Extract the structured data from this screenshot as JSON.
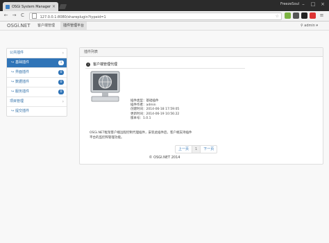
{
  "browser": {
    "tab_title": "OSGi System Manager",
    "tab_close": "×",
    "profile": "FreezeSoul",
    "minimize": "–",
    "maximize": "□",
    "close": "×",
    "back": "←",
    "forward": "→",
    "reload": "C",
    "url": "127.0.0.1:8080/shareplugin?typeid=1",
    "star": "☆"
  },
  "navbar": {
    "brand": "OSGi.NET",
    "items": [
      "客户端管理",
      "插件管理平台"
    ],
    "user": "admin"
  },
  "sidebar": {
    "items": [
      {
        "label": "公共插件",
        "chev": "›"
      },
      {
        "label": "基础插件",
        "badge": "1"
      },
      {
        "label": "界面插件",
        "badge": "0"
      },
      {
        "label": "数据插件",
        "badge": "0"
      },
      {
        "label": "服务插件",
        "badge": "0"
      },
      {
        "label": "项目管理",
        "chev": "›"
      },
      {
        "label": "提交插件"
      }
    ]
  },
  "panel": {
    "header": "插件列表",
    "plugin_name": "客户端管理代理",
    "info": [
      "插件类型：基础插件",
      "插件作者：admin",
      "创建时间：2014-06-18 17:59:05",
      "更新时间：2014-06-19 10:56:22",
      "版本号：1.0.1"
    ],
    "description_1": "OSGi.NET框架客户端远程控制代理插件，安装此插件后，客户端支持插件",
    "description_2": "平台的监控和管理功能。",
    "pager_prev": "上一页",
    "pager_current": "1",
    "pager_next": "下一页"
  },
  "footer": "© OSGI.NET 2014"
}
